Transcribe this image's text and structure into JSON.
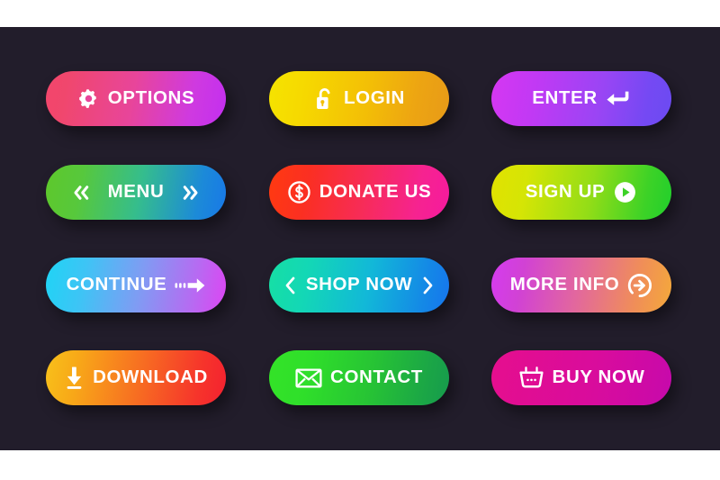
{
  "page": {
    "background_color": "#ffffff",
    "panel_color": "#221d2b",
    "label_color": "#ffffff"
  },
  "buttons": [
    {
      "id": "options",
      "label": "OPTIONS",
      "icon": "gear-icon",
      "icon_position": "left",
      "gradient_from": "#f4456b",
      "gradient_to": "#c32ff0"
    },
    {
      "id": "login",
      "label": "LOGIN",
      "icon": "unlock-icon",
      "icon_position": "left",
      "gradient_from": "#f5e400",
      "gradient_to": "#e79a18"
    },
    {
      "id": "enter",
      "label": "ENTER",
      "icon": "enter-return-arrow-icon",
      "icon_position": "right",
      "gradient_from": "#d637f2",
      "gradient_to": "#6b4bf2"
    },
    {
      "id": "menu",
      "label": "MENU",
      "icon": "double-chevron-left-icon",
      "icon_right": "double-chevron-right-icon",
      "icon_position": "both",
      "gradient_from": "#5ec82b",
      "gradient_to": "#1878e8"
    },
    {
      "id": "donate-us",
      "label": "DONATE US",
      "icon": "dollar-circle-icon",
      "icon_position": "left",
      "gradient_from": "#ff3a10",
      "gradient_to": "#f51a9e"
    },
    {
      "id": "sign-up",
      "label": "SIGN UP",
      "icon": "play-circle-icon",
      "icon_position": "right",
      "gradient_from": "#e2e200",
      "gradient_to": "#21cf2c"
    },
    {
      "id": "continue",
      "label": "CONTINUE",
      "icon": "motion-arrow-right-icon",
      "icon_position": "right",
      "gradient_from": "#1fd4f5",
      "gradient_to": "#dd45f3"
    },
    {
      "id": "shop-now",
      "label": "SHOP NOW",
      "icon": "chevron-left-icon",
      "icon_right": "chevron-right-icon",
      "icon_position": "both",
      "gradient_from": "#16dfa4",
      "gradient_to": "#1675ee"
    },
    {
      "id": "more-info",
      "label": "MORE INFO",
      "icon": "arrow-into-circle-icon",
      "icon_position": "right",
      "gradient_from": "#d53bf0",
      "gradient_to": "#f4a93a"
    },
    {
      "id": "download",
      "label": "DOWNLOAD",
      "icon": "download-arrow-icon",
      "icon_position": "left",
      "gradient_from": "#f8c11a",
      "gradient_to": "#f42130"
    },
    {
      "id": "contact",
      "label": "CONTACT",
      "icon": "envelope-icon",
      "icon_position": "left",
      "gradient_from": "#34e328",
      "gradient_to": "#169b4d"
    },
    {
      "id": "buy-now",
      "label": "BUY NOW",
      "icon": "shopping-basket-icon",
      "icon_position": "left",
      "gradient_from": "#e60e8e",
      "gradient_to": "#c609ac"
    }
  ]
}
